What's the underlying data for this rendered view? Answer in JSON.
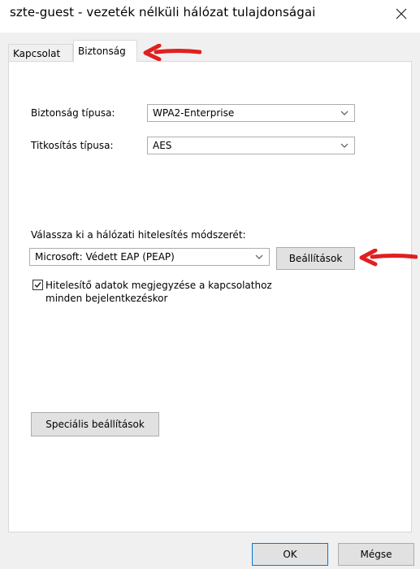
{
  "window": {
    "title": "szte-guest - vezeték nélküli hálózat tulajdonságai"
  },
  "tabs": [
    {
      "label": "Kapcsolat"
    },
    {
      "label": "Biztonság"
    }
  ],
  "security": {
    "type_label": "Biztonság típusa:",
    "type_value": "WPA2-Enterprise",
    "encryption_label": "Titkosítás típusa:",
    "encryption_value": "AES"
  },
  "auth": {
    "method_label": "Válassza ki a hálózati hitelesítés módszerét:",
    "method_value": "Microsoft: Védett EAP (PEAP)",
    "settings_button": "Beállítások",
    "remember_line1": "Hitelesítő adatok megjegyzése a kapcsolathoz",
    "remember_line2": "minden bejelentkezéskor",
    "remember_checked": true
  },
  "advanced_button": "Speciális beállítások",
  "footer": {
    "ok": "OK",
    "cancel": "Mégse"
  },
  "colors": {
    "annotation_arrow": "#e02020"
  }
}
